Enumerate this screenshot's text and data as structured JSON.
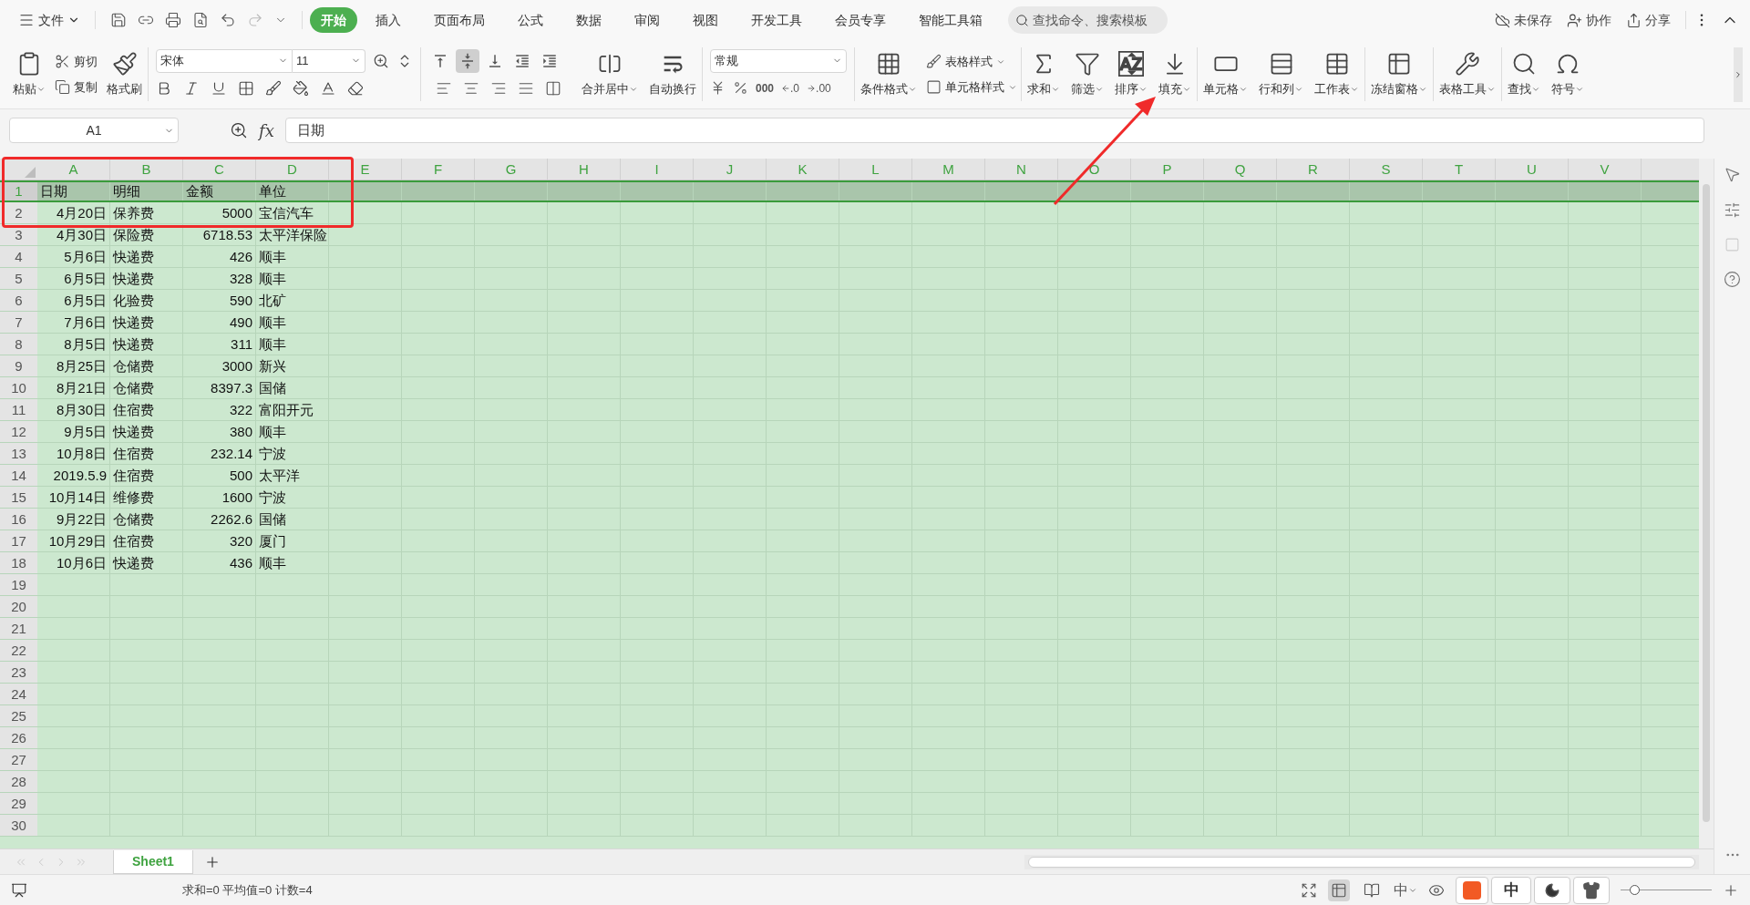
{
  "menu": {
    "file": "文件",
    "tabs": [
      {
        "label": "开始",
        "selected": true
      },
      {
        "label": "插入",
        "selected": false
      },
      {
        "label": "页面布局",
        "selected": false
      },
      {
        "label": "公式",
        "selected": false
      },
      {
        "label": "数据",
        "selected": false
      },
      {
        "label": "审阅",
        "selected": false
      },
      {
        "label": "视图",
        "selected": false
      },
      {
        "label": "开发工具",
        "selected": false
      },
      {
        "label": "会员专享",
        "selected": false
      },
      {
        "label": "智能工具箱",
        "selected": false
      }
    ],
    "search": {
      "placeholder": "查找命令、搜索模板"
    },
    "actions": [
      "未保存",
      "协作",
      "分享"
    ]
  },
  "ribbon": {
    "clipboard": {
      "paste": "粘贴",
      "cut": "剪切",
      "copy": "复制",
      "painter": "格式刷"
    },
    "font": {
      "name": "宋体",
      "size": "11"
    },
    "vertical_align": [
      {
        "selected": false
      },
      {
        "selected": true
      },
      {
        "selected": false
      }
    ],
    "align": {
      "merge": "合并居中",
      "wrap": "自动换行"
    },
    "number": {
      "format": "常规",
      "thousands": "000",
      "decimals": [
        ".0",
        ".00"
      ]
    },
    "styles": {
      "conditional": "条件格式",
      "table_style": "表格样式",
      "cell_style": "单元格样式"
    },
    "tools": [
      "求和",
      "筛选",
      "排序",
      "填充",
      "单元格",
      "行和列",
      "工作表",
      "冻结窗格",
      "表格工具",
      "查找",
      "符号"
    ]
  },
  "formula_bar": {
    "name_box": "A1",
    "fx_label": "fx",
    "formula": "日期"
  },
  "sheet": {
    "columns": [
      "A",
      "B",
      "C",
      "D",
      "E",
      "F",
      "G",
      "H",
      "I",
      "J",
      "K",
      "L",
      "M",
      "N",
      "O",
      "P",
      "Q",
      "R",
      "S",
      "T",
      "U",
      "V"
    ],
    "rows": [
      {
        "number": "1",
        "selected": true,
        "cells": [
          "日期",
          "明细",
          "金额",
          "单位"
        ]
      },
      {
        "number": "2",
        "selected": false,
        "cells": [
          "4月20日",
          "保养费",
          "5000",
          "宝信汽车"
        ]
      },
      {
        "number": "3",
        "selected": false,
        "cells": [
          "4月30日",
          "保险费",
          "6718.53",
          "太平洋保险"
        ]
      },
      {
        "number": "4",
        "selected": false,
        "cells": [
          "5月6日",
          "快递费",
          "426",
          "顺丰"
        ]
      },
      {
        "number": "5",
        "selected": false,
        "cells": [
          "6月5日",
          "快递费",
          "328",
          "顺丰"
        ]
      },
      {
        "number": "6",
        "selected": false,
        "cells": [
          "6月5日",
          "化验费",
          "590",
          "北矿"
        ]
      },
      {
        "number": "7",
        "selected": false,
        "cells": [
          "7月6日",
          "快递费",
          "490",
          "顺丰"
        ]
      },
      {
        "number": "8",
        "selected": false,
        "cells": [
          "8月5日",
          "快递费",
          "311",
          "顺丰"
        ]
      },
      {
        "number": "9",
        "selected": false,
        "cells": [
          "8月25日",
          "仓储费",
          "3000",
          "新兴"
        ]
      },
      {
        "number": "10",
        "selected": false,
        "cells": [
          "8月21日",
          "仓储费",
          "8397.3",
          "国储"
        ]
      },
      {
        "number": "11",
        "selected": false,
        "cells": [
          "8月30日",
          "住宿费",
          "322",
          "富阳开元"
        ]
      },
      {
        "number": "12",
        "selected": false,
        "cells": [
          "9月5日",
          "快递费",
          "380",
          "顺丰"
        ]
      },
      {
        "number": "13",
        "selected": false,
        "cells": [
          "10月8日",
          "住宿费",
          "232.14",
          "宁波"
        ]
      },
      {
        "number": "14",
        "selected": false,
        "cells": [
          "2019.5.9",
          "住宿费",
          "500",
          "太平洋"
        ]
      },
      {
        "number": "15",
        "selected": false,
        "cells": [
          "10月14日",
          "维修费",
          "1600",
          "宁波"
        ]
      },
      {
        "number": "16",
        "selected": false,
        "cells": [
          "9月22日",
          "仓储费",
          "2262.6",
          "国储"
        ]
      },
      {
        "number": "17",
        "selected": false,
        "cells": [
          "10月29日",
          "住宿费",
          "320",
          "厦门"
        ]
      },
      {
        "number": "18",
        "selected": false,
        "cells": [
          "10月6日",
          "快递费",
          "436",
          "顺丰"
        ]
      },
      {
        "number": "19",
        "selected": false
      },
      {
        "number": "20",
        "selected": false
      },
      {
        "number": "21",
        "selected": false
      },
      {
        "number": "22",
        "selected": false
      },
      {
        "number": "23",
        "selected": false
      },
      {
        "number": "24",
        "selected": false
      },
      {
        "number": "25",
        "selected": false
      },
      {
        "number": "26",
        "selected": false
      },
      {
        "number": "27",
        "selected": false
      },
      {
        "number": "28",
        "selected": false
      },
      {
        "number": "29",
        "selected": false
      },
      {
        "number": "30",
        "selected": false
      }
    ]
  },
  "sheet_tabs": [
    {
      "label": "Sheet1",
      "selected": true
    }
  ],
  "status_bar": {
    "summary": "求和=0 平均值=0 计数=4",
    "views": [
      {
        "kind": "normal",
        "selected": true
      },
      {
        "kind": "page",
        "selected": false
      }
    ],
    "reading_label": "中",
    "zoom": {
      "level": 0.15
    }
  },
  "ime": {
    "label": "中"
  }
}
